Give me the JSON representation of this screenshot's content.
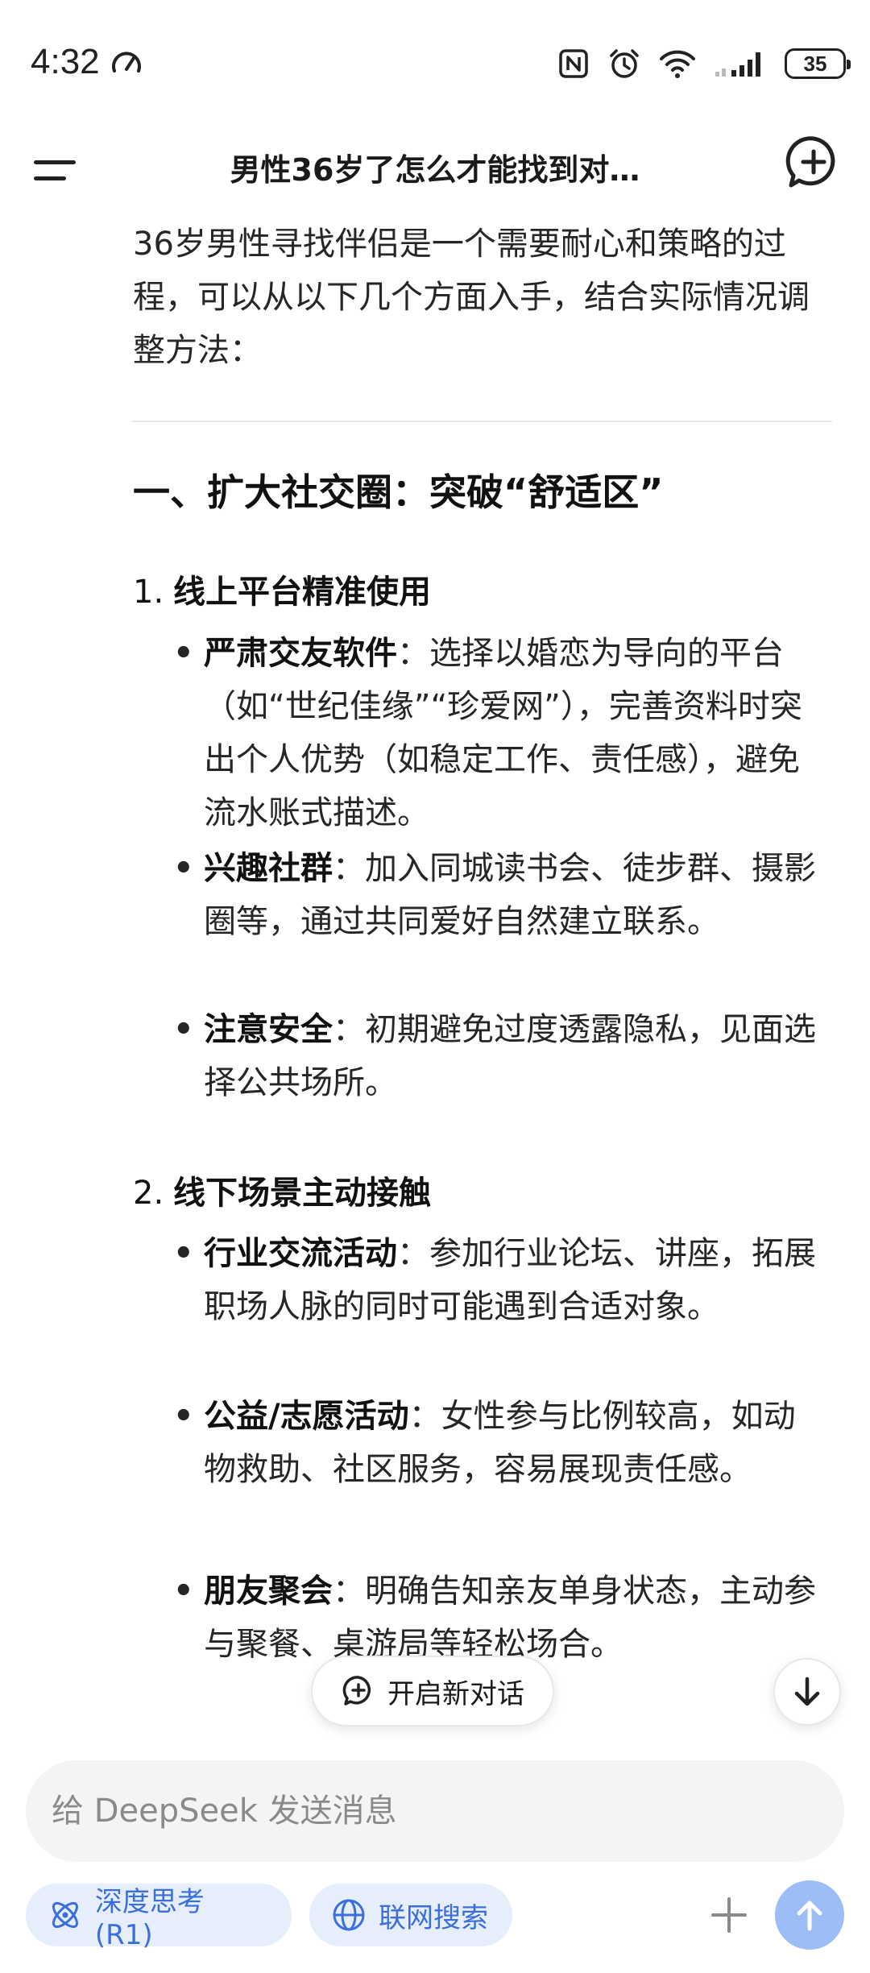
{
  "status_bar": {
    "time": "4:32",
    "battery": "35",
    "icons": [
      "speed-icon",
      "nfc-icon",
      "alarm-icon",
      "wifi-icon",
      "signal-icon",
      "battery-icon"
    ]
  },
  "header": {
    "title": "男性36岁了怎么才能找到对…",
    "menu_icon": "menu-icon",
    "new_chat_icon": "chat-plus-icon"
  },
  "message": {
    "intro": "36岁男性寻找伴侣是一个需要耐心和策略的过程，可以从以下几个方面入手，结合实际情况调整方法：",
    "section_heading": "一、扩大社交圈：突破“舒适区”",
    "items": [
      {
        "num": "1.",
        "title": "线上平台精准使用",
        "bullets": [
          {
            "label": "严肃交友软件",
            "text": "：选择以婚恋为导向的平台（如“世纪佳缘”“珍爱网”），完善资料时突出个人优势（如稳定工作、责任感），避免流水账式描述。"
          },
          {
            "label": "兴趣社群",
            "text": "：加入同城读书会、徒步群、摄影圈等，通过共同爱好自然建立联系。"
          },
          {
            "label": "注意安全",
            "text": "：初期避免过度透露隐私，见面选择公共场所。"
          }
        ]
      },
      {
        "num": "2.",
        "title": "线下场景主动接触",
        "bullets": [
          {
            "label": "行业交流活动",
            "text": "：参加行业论坛、讲座，拓展职场人脉的同时可能遇到合适对象。"
          },
          {
            "label": "公益/志愿活动",
            "text": "：女性参与比例较高，如动物救助、社区服务，容易展现责任感。"
          },
          {
            "label": "朋友聚会",
            "text": "：明确告知亲友单身状态，主动参与聚餐、桌游局等轻松场合。"
          }
        ]
      }
    ]
  },
  "floating": {
    "new_chat_label": "开启新对话"
  },
  "composer": {
    "placeholder": "给 DeepSeek 发送消息",
    "deep_think_label": "深度思考 (R1)",
    "web_search_label": "联网搜索"
  },
  "colors": {
    "accent": "#3a6fdc",
    "chip_bg": "#e6eefc",
    "send_disabled": "#9cbdf6",
    "input_bg": "#f3f4f6"
  }
}
